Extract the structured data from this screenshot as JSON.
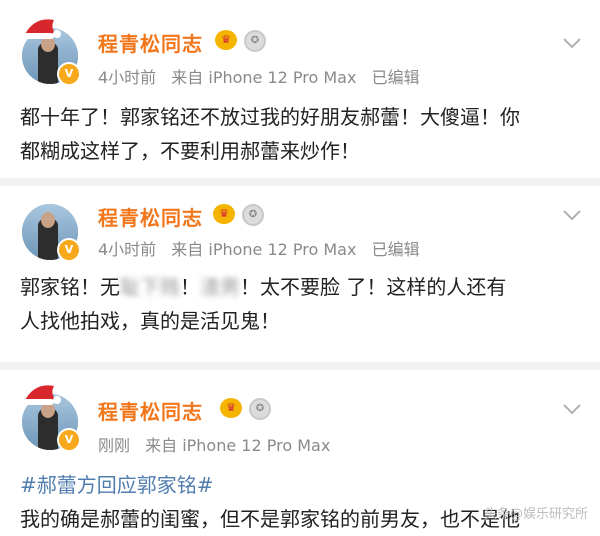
{
  "posts": [
    {
      "author": "程青松同志",
      "crown_glyph": "♛",
      "medal_glyph": "✪",
      "time": "4小时前",
      "source": "来自 iPhone 12 Pro Max",
      "edited": "已编辑",
      "text_a": "都十年了！郭家铭还不放过我的好朋友郝蕾！大傻逼！你",
      "text_b": "都糊成这样了，不要利用郝蕾来炒作！"
    },
    {
      "author": "程青松同志",
      "crown_glyph": "♛",
      "medal_glyph": "✪",
      "time": "4小时前",
      "source": "来自 iPhone 12 Pro Max",
      "edited": "已编辑",
      "text_a1": "郭家铭！无",
      "text_a_blur1": "耻下贱",
      "text_a2": "！",
      "text_a_blur2": "渣男",
      "text_a3": "！太不要脸 了！这样的人还有",
      "text_b": "人找他拍戏，真的是活见鬼！"
    },
    {
      "author": "程青松同志",
      "crown_glyph": "♛",
      "medal_glyph": "✪",
      "time": "刚刚",
      "source": "来自 iPhone 12 Pro Max",
      "topic": "#郝蕾方回应郭家铭#",
      "text_a": "我的确是郝蕾的闺蜜，但不是郭家铭的前男友，也不是他"
    }
  ],
  "avatar_badge": "V",
  "watermark": "头条@娱乐研究所",
  "colors": {
    "author_name": "#f2761a",
    "topic_link": "#507daf",
    "meta_gray": "#8a8a8a",
    "separator": "#f1f1f1"
  },
  "icons": [
    "santa-hat-icon",
    "verified-badge-icon",
    "crown-icon",
    "medal-icon",
    "chevron-down-icon"
  ]
}
